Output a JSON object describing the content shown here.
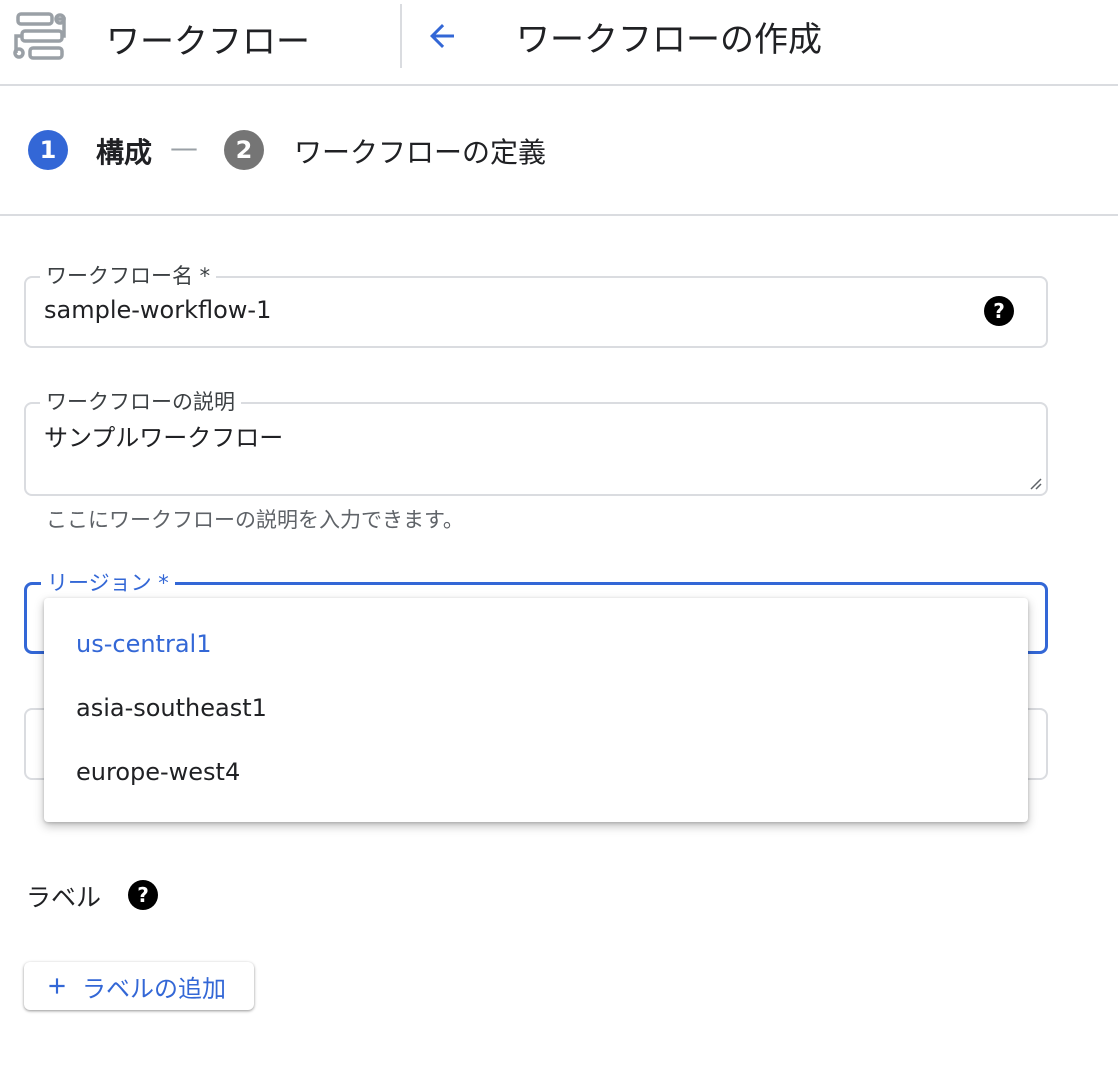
{
  "header": {
    "product_title": "ワークフロー",
    "page_title": "ワークフローの作成",
    "product_icon": "workflows-icon",
    "back_icon": "arrow-back-icon"
  },
  "stepper": {
    "step1": {
      "number": "1",
      "label": "構成"
    },
    "separator": "—",
    "step2": {
      "number": "2",
      "label": "ワークフローの定義"
    }
  },
  "form": {
    "name": {
      "label": "ワークフロー名 *",
      "value": "sample-workflow-1",
      "help_icon": "help-icon"
    },
    "description": {
      "label": "ワークフローの説明",
      "value": "サンプルワークフロー",
      "hint": "ここにワークフローの説明を入力できます。"
    },
    "region": {
      "label": "リージョン *",
      "options": [
        "us-central1",
        "asia-southeast1",
        "europe-west4"
      ],
      "selected": "us-central1"
    }
  },
  "labels": {
    "heading": "ラベル",
    "help_icon": "help-icon",
    "add_button": "ラベルの追加",
    "add_icon": "plus-icon"
  },
  "colors": {
    "accent": "#3367d6",
    "step_inactive": "#757575",
    "border": "#dadce0",
    "hint_text": "#5f6368"
  }
}
